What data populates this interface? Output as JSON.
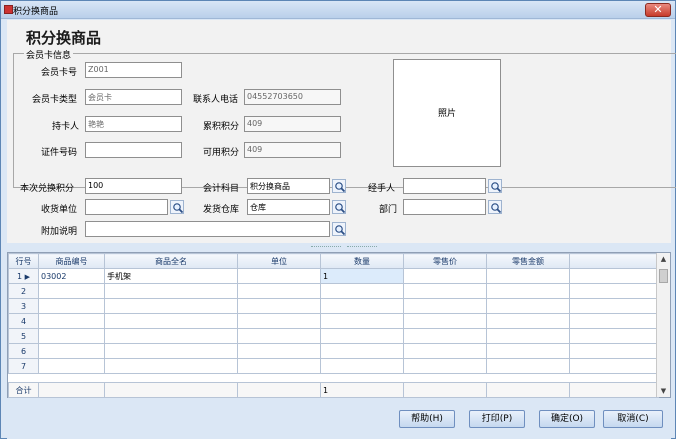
{
  "window": {
    "title": "积分换商品",
    "close_glyph": "✕"
  },
  "page_title": "积分换商品",
  "member_group": {
    "legend": "会员卡信息",
    "card_no": {
      "label": "会员卡号",
      "value": "Z001"
    },
    "card_type": {
      "label": "会员卡类型",
      "value": "会员卡"
    },
    "holder": {
      "label": "持卡人",
      "value": "艳艳"
    },
    "id_no": {
      "label": "证件号码",
      "value": ""
    },
    "phone": {
      "label": "联系人电话",
      "value": "04552703650"
    },
    "total_points": {
      "label": "累积积分",
      "value": "409"
    },
    "usable_points": {
      "label": "可用积分",
      "value": "409"
    },
    "photo_label": "照片"
  },
  "exchange": {
    "points": {
      "label": "本次兑换积分",
      "value": "100"
    },
    "account": {
      "label": "会计科目",
      "value": "积分换商品"
    },
    "handler": {
      "label": "经手人",
      "value": ""
    },
    "receiver": {
      "label": "收货单位",
      "value": ""
    },
    "warehouse": {
      "label": "发货仓库",
      "value": "仓库"
    },
    "department": {
      "label": "部门",
      "value": ""
    },
    "note": {
      "label": "附加说明",
      "value": ""
    }
  },
  "grid": {
    "columns": [
      "行号",
      "商品编号",
      "商品全名",
      "单位",
      "数量",
      "零售价",
      "零售金额"
    ],
    "rows": [
      {
        "no": "1",
        "code": "03002",
        "name": "手机架",
        "unit": "",
        "qty": "1",
        "price": "",
        "amount": ""
      },
      {
        "no": "2",
        "code": "",
        "name": "",
        "unit": "",
        "qty": "",
        "price": "",
        "amount": ""
      },
      {
        "no": "3",
        "code": "",
        "name": "",
        "unit": "",
        "qty": "",
        "price": "",
        "amount": ""
      },
      {
        "no": "4",
        "code": "",
        "name": "",
        "unit": "",
        "qty": "",
        "price": "",
        "amount": ""
      },
      {
        "no": "5",
        "code": "",
        "name": "",
        "unit": "",
        "qty": "",
        "price": "",
        "amount": ""
      },
      {
        "no": "6",
        "code": "",
        "name": "",
        "unit": "",
        "qty": "",
        "price": "",
        "amount": ""
      },
      {
        "no": "7",
        "code": "",
        "name": "",
        "unit": "",
        "qty": "",
        "price": "",
        "amount": ""
      }
    ],
    "total_label": "合计",
    "total_qty": "1",
    "current_row_marker": "▶"
  },
  "buttons": {
    "help": "帮助(H)",
    "print": "打印(P)",
    "ok": "确定(O)",
    "cancel": "取消(C)"
  },
  "icons": {
    "lookup": "magnifier-icon",
    "app": "app-icon"
  },
  "colors": {
    "accent": "#2f6fd0",
    "title_bar": "#b9cfea",
    "close": "#c73b2b"
  }
}
